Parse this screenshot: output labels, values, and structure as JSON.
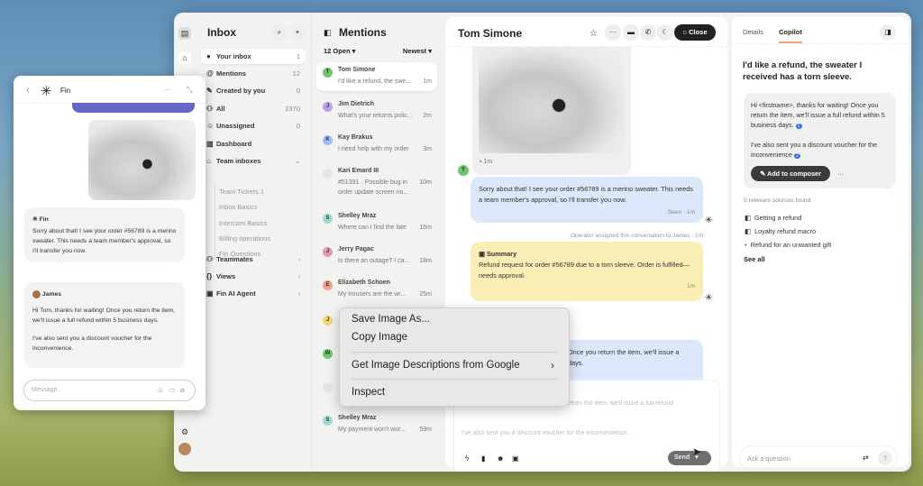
{
  "rail": {
    "icons": [
      "inbox-app-icon",
      "inbox-icon",
      "settings-icon",
      "profile-icon"
    ]
  },
  "inbox": {
    "title": "Inbox",
    "nav": [
      {
        "label": "Your inbox",
        "count": "1",
        "icon": "avatar-icon"
      },
      {
        "label": "Mentions",
        "count": "12",
        "icon": "at-icon"
      },
      {
        "label": "Created by you",
        "count": "0",
        "icon": "pen-icon"
      },
      {
        "label": "All",
        "count": "2370",
        "icon": "people-icon"
      },
      {
        "label": "Unassigned",
        "count": "0",
        "icon": "unassigned-icon"
      },
      {
        "label": "Dashboard",
        "count": "",
        "icon": "chart-icon"
      },
      {
        "label": "Team inboxes",
        "count": "",
        "icon": "inbox-icon"
      }
    ],
    "team_inboxes": [
      "Team Tickets 1",
      "Inbox Basics",
      "Intercom Basics",
      "Billing operations",
      "Fin Questions"
    ],
    "bottom_nav": [
      {
        "label": "Teammates"
      },
      {
        "label": "Views"
      },
      {
        "label": "Fin AI Agent"
      }
    ]
  },
  "mentions": {
    "title": "Mentions",
    "filter": "12 Open",
    "sort": "Newest",
    "items": [
      {
        "initial": "T",
        "name": "Tom Simone",
        "preview": "I'd like a refund, the swe...",
        "time": "1m",
        "color": "#6cc66a"
      },
      {
        "initial": "J",
        "name": "Jim Dietrich",
        "preview": "What's your returns polic...",
        "time": "2m",
        "color": "#b6a2ee"
      },
      {
        "initial": "K",
        "name": "Kay Brakus",
        "preview": "I need help with my order",
        "time": "3m",
        "color": "#9fbdf2"
      },
      {
        "initial": "",
        "name": "Kari Emard III",
        "preview": "#51391 · Possible bug in order update screen no...",
        "time": "10m",
        "color": "#e4e4e4"
      },
      {
        "initial": "S",
        "name": "Shelley Mraz",
        "preview": "Where can I find the late",
        "time": "15m",
        "color": "#9fdcd4"
      },
      {
        "initial": "J",
        "name": "Jerry Pagac",
        "preview": "Is there an outage? I ca...",
        "time": "18m",
        "color": "#e596b5"
      },
      {
        "initial": "E",
        "name": "Elizabeth Schoen",
        "preview": "My trousers are the wr...",
        "time": "25m",
        "color": "#eea083"
      },
      {
        "initial": "J",
        "name": "",
        "preview": "",
        "time": "",
        "color": "#f2d76a"
      },
      {
        "initial": "W",
        "name": "",
        "preview": "",
        "time": "",
        "color": "#6cc66a"
      },
      {
        "initial": "",
        "name": "",
        "preview": "",
        "time": "",
        "color": "#e4e4e4"
      },
      {
        "initial": "S",
        "name": "Shelley Mraz",
        "preview": "My payment won't wor...",
        "time": "59m",
        "color": "#9fdcd4"
      }
    ]
  },
  "conversation": {
    "title": "Tom Simone",
    "close_label": "Close",
    "image_time": "1m",
    "avatar": "T",
    "fin_reply": "Sorry about that! I see your order #56789 is a merino sweater. This needs a team member's approval, so I'll transfer you now.",
    "fin_meta": "Seen · 1m",
    "event": "Operator assigned this conversation to James · 1m",
    "summary_title": "Summary",
    "summary_text": "Refund request for order #56789 due to a torn sleeve. Order is fulfilled—needs approval.",
    "summary_time": "1m",
    "partial_reply_line1": "Once you return the item, we'll issue a",
    "partial_reply_line2": "days.",
    "composer_line1": "Hi Tom, thanks for waiting! Once you return the item, we'll issue a full refund",
    "composer_line2": "I've also sent you a discount voucher for the inconvenience.",
    "send_label": "Send"
  },
  "copilot": {
    "tabs": [
      "Details",
      "Copilot"
    ],
    "active_tab": "Copilot",
    "question": "I'd like a refund, the sweater I received has a torn sleeve.",
    "answer_p1": "Hi <firstname>, thanks for waiting! Once you return the item, we'll issue a full refund within 5 business days.",
    "ref1": "1",
    "answer_p2": "I've also sent you a discount voucher for the inconvenience",
    "ref2": "2",
    "add_label": "Add to composer",
    "sources_label": "5 relevant sources found",
    "sources": [
      "Getting a refund",
      "Loyalty refund macro",
      "Refund for an unwanted gift"
    ],
    "see_all": "See all",
    "ask_placeholder": "Ask a question",
    "accent": "#f0a27a"
  },
  "fin_widget": {
    "title": "Fin",
    "bot_name": "Fin",
    "bot_msg": "Sorry about that! I see your order #56789 is a merino sweater. This needs a team member's approval, so I'll transfer you now.",
    "agent_name": "James",
    "agent_msg_p1": "Hi Tom, thanks for waiting! Once you return the item, we'll issue a full refund within 5 business days.",
    "agent_msg_p2": "I've also sent you a discount voucher for the inconvenience.",
    "placeholder": "Message...",
    "accent": "#6466c8"
  },
  "context_menu": {
    "items": [
      "Save Image As...",
      "Copy Image",
      "Get Image Descriptions from Google",
      "Inspect"
    ]
  }
}
